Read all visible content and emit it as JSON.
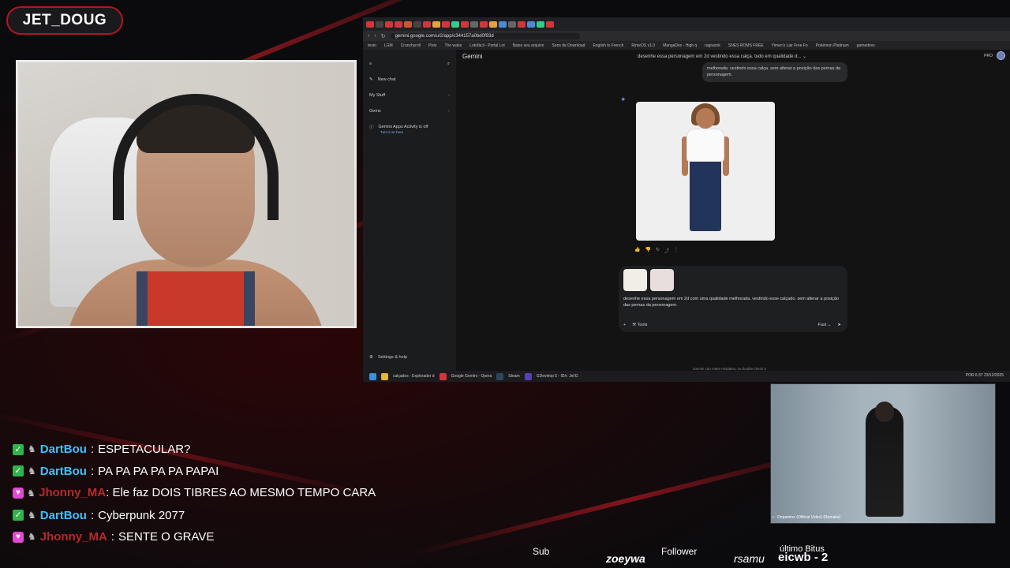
{
  "streamer": {
    "name": "JET_DOUG"
  },
  "browser": {
    "url": "gemini.google.com/u/2/app/c344157a0bd0f93d",
    "bookmarks": [
      "testo",
      "LGM",
      "Crunchyroll",
      "Pixiv",
      "The wake",
      "Lotofácil - Portal Lot",
      "Baixe seu arquivo",
      "Sons de Download",
      "English to French",
      "RimeOS v1.0",
      "MangaDex - High q",
      "ragnarok",
      "SNES ROMS FREE",
      "Yimen's Lair Free Fo",
      "Pokémon Platinum",
      "gamedevs"
    ]
  },
  "gemini": {
    "app_title": "Gemini",
    "conversation_title": "desenhe essa personagem em 2d vestindo essa calça. tudo em qualidade d...",
    "pro_label": "PRO",
    "avatar_letter": "D",
    "sidebar": {
      "new_chat": "New chat",
      "my_stuff": "My Stuff",
      "gems": "Gems",
      "activity_title": "Gemini Apps Activity is off",
      "activity_link": "Turn it on here",
      "settings": "Settings & help"
    },
    "user_bubble": "melhorada. vestindo essa calça. sem alterar a posição das pernas da personagem.",
    "prompt_text": "desenhe essa personagem em 2d com uma qualidade melhorada. vestindo esse calçado. sem alterar a posição das pernas da personagem.",
    "tools_label": "Tools",
    "fast_label": "Fast",
    "disclaimer": "Gemini can make mistakes, so double-check it"
  },
  "taskbar": {
    "items": [
      "calçados - Explorador d",
      "Google Gemini - Opera",
      "Steam",
      "GDevelop 5 - ID/r. Jet'G"
    ],
    "lang": "POR",
    "time": "6:37",
    "date": "23/12/2025"
  },
  "video": {
    "caption": "• - Dopamine (Official Video) (Remake)"
  },
  "chat": [
    {
      "badge": "mod",
      "user": "DartBou",
      "text": "ESPETACULAR?"
    },
    {
      "badge": "mod",
      "user": "DartBou",
      "text": "PA PA PA PA PA PAPAI"
    },
    {
      "badge": "sub",
      "user": "Jhonny_MA",
      "text": "Ele faz DOIS TIBRES AO MESMO TEMPO CARA"
    },
    {
      "badge": "mod",
      "user": "DartBou",
      "text": "Cyberpunk 2077"
    },
    {
      "badge": "sub",
      "user": "Jhonny_MA",
      "text": "SENTE O GRAVE"
    }
  ],
  "ticker": {
    "sub_label": "Sub",
    "sub_name": "zoeywa",
    "follower_label": "Follower",
    "follower_name": "rsamu",
    "bits_label": "último Bitus",
    "bits_value": "eicwb - 2"
  },
  "colors": {
    "accent": "#b41620",
    "chat_user_mod": "#3ec1ff",
    "chat_user_sub": "#b72a2a",
    "gemini_link": "#8ab4f8"
  }
}
